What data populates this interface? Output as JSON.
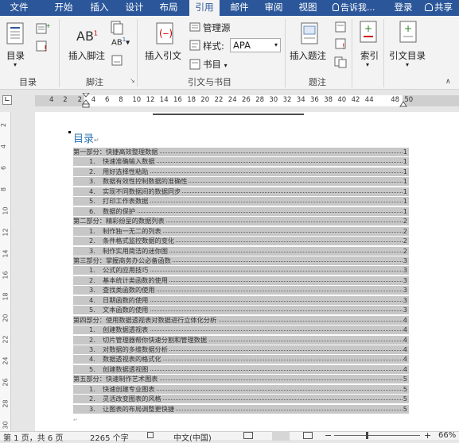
{
  "tabs": [
    "文件",
    "开始",
    "插入",
    "设计",
    "布局",
    "引用",
    "邮件",
    "审阅",
    "视图"
  ],
  "tell_me": "告诉我...",
  "login": "登录",
  "share": "共享",
  "ribbon": {
    "toc_btn": "目录",
    "toc_group": "目录",
    "insert_footnote": "插入脚注",
    "footnote_group": "脚注",
    "insert_citation": "插入引文",
    "manage_sources": "管理源",
    "style_label": "样式:",
    "style_value": "APA",
    "bibliography": "书目",
    "citation_group": "引文与书目",
    "insert_caption": "插入题注",
    "caption_group": "题注",
    "index": "索引",
    "citation_toc": "引文目录"
  },
  "ruler_numbers": [
    "4",
    "2",
    "",
    "2",
    "4",
    "6",
    "8",
    "10",
    "12",
    "14",
    "16",
    "18",
    "20",
    "22",
    "24",
    "26",
    "28",
    "30",
    "32",
    "34",
    "36",
    "38",
    "40",
    "42",
    "44",
    "",
    "48",
    "50"
  ],
  "vruler_numbers": [
    "2",
    "4",
    "6",
    "8",
    "10",
    "12",
    "14",
    "16",
    "18",
    "20",
    "22",
    "24",
    "26",
    "28",
    "30"
  ],
  "doc": {
    "toc_title": "目录",
    "entries": [
      {
        "level": 1,
        "num": "",
        "text": "第一部分：快捷高效整理数据",
        "page": "1"
      },
      {
        "level": 2,
        "num": "1.",
        "text": "快速准确输入数据",
        "page": "1"
      },
      {
        "level": 2,
        "num": "2.",
        "text": "用好选择性粘贴",
        "page": "1"
      },
      {
        "level": 2,
        "num": "3.",
        "text": "数据有效性控制数据的准确性",
        "page": "1"
      },
      {
        "level": 2,
        "num": "4.",
        "text": "实现不同数据间的数据同步",
        "page": "1"
      },
      {
        "level": 2,
        "num": "5.",
        "text": "打印工作表数据",
        "page": "1"
      },
      {
        "level": 2,
        "num": "6.",
        "text": "数据的保护",
        "page": "1"
      },
      {
        "level": 1,
        "num": "",
        "text": "第二部分：精彩纷呈的数据列表",
        "page": "2"
      },
      {
        "level": 2,
        "num": "1.",
        "text": "制作独一无二的列表",
        "page": "2"
      },
      {
        "level": 2,
        "num": "2.",
        "text": "条件格式监控数据的变化",
        "page": "2"
      },
      {
        "level": 2,
        "num": "3.",
        "text": "制作实用简洁的迷你图",
        "page": "2"
      },
      {
        "level": 1,
        "num": "",
        "text": "第三部分：掌握商务办公必备函数",
        "page": "3"
      },
      {
        "level": 2,
        "num": "1.",
        "text": "公式的应用技巧",
        "page": "3"
      },
      {
        "level": 2,
        "num": "2.",
        "text": "基本统计类函数的使用",
        "page": "3"
      },
      {
        "level": 2,
        "num": "3.",
        "text": "查找类函数的使用",
        "page": "3"
      },
      {
        "level": 2,
        "num": "4.",
        "text": "日期函数的使用",
        "page": "3"
      },
      {
        "level": 2,
        "num": "5.",
        "text": "文本函数的使用",
        "page": "3"
      },
      {
        "level": 1,
        "num": "",
        "text": "第四部分：使用数据透视表对数据进行立体化分析",
        "page": "4"
      },
      {
        "level": 2,
        "num": "1.",
        "text": "创建数据透视表",
        "page": "4"
      },
      {
        "level": 2,
        "num": "2.",
        "text": "切片管理器帮你快速分割和管理数据",
        "page": "4"
      },
      {
        "level": 2,
        "num": "3.",
        "text": "对数据的多维数据分析",
        "page": "4"
      },
      {
        "level": 2,
        "num": "4.",
        "text": "数据透视表的格式化",
        "page": "4"
      },
      {
        "level": 2,
        "num": "5.",
        "text": "创建数据透视图",
        "page": "4"
      },
      {
        "level": 1,
        "num": "",
        "text": "第五部分：快速制作艺术图表",
        "page": "5"
      },
      {
        "level": 2,
        "num": "1.",
        "text": "快速创建专业图表",
        "page": "5"
      },
      {
        "level": 2,
        "num": "2.",
        "text": "灵活改变图表的风格",
        "page": "5"
      },
      {
        "level": 2,
        "num": "3.",
        "text": "让图表的布局调整更快捷",
        "page": "5"
      }
    ]
  },
  "status": {
    "page": "第 1 页，共 6 页",
    "words": "2265 个字",
    "lang": "中文(中国)",
    "zoom": "66%"
  }
}
